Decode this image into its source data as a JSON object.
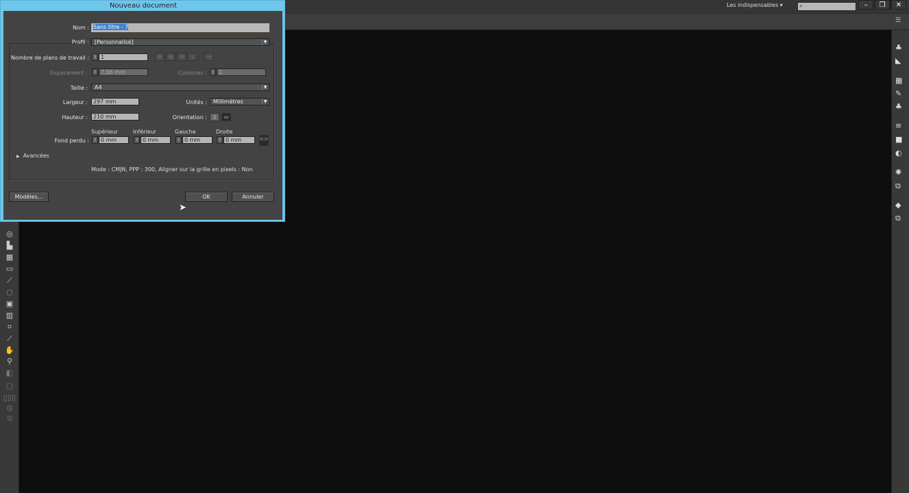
{
  "app": {
    "workspace": "Les indispensables",
    "search_placeholder": "",
    "search_icon": "magnifier",
    "window": {
      "min": "–",
      "restore": "❐",
      "close": "✕"
    }
  },
  "dialog": {
    "title": "Nouveau document",
    "nom_label": "Nom :",
    "nom_value": "Sans titre - 7",
    "profil_label": "Profil :",
    "profil_value": "[Personnalisé]",
    "artboards_label": "Nombre de plans de travail :",
    "artboards_value": "1",
    "spacing_label": "Espacement :",
    "spacing_value": "7,06 mm",
    "columns_label": "Colonnes :",
    "columns_value": "1",
    "size_label": "Taille :",
    "size_value": "A4",
    "width_label": "Largeur :",
    "width_value": "297 mm",
    "units_label": "Unités :",
    "units_value": "Millimètres",
    "height_label": "Hauteur :",
    "height_value": "210 mm",
    "orientation_label": "Orientation :",
    "bleed_label": "Fond perdu :",
    "bleed": [
      {
        "label": "Supérieur",
        "value": "0 mm"
      },
      {
        "label": "Inférieur",
        "value": "0 mm"
      },
      {
        "label": "Gauche",
        "value": "0 mm"
      },
      {
        "label": "Droite",
        "value": "0 mm"
      }
    ],
    "advanced_label": "Avancées",
    "summary": "Mode : CMJN, PPP : 300, Aligner sur la grille en pixels : Non",
    "templates_button": "Modèles...",
    "ok_button": "OK",
    "cancel_button": "Annuler"
  }
}
